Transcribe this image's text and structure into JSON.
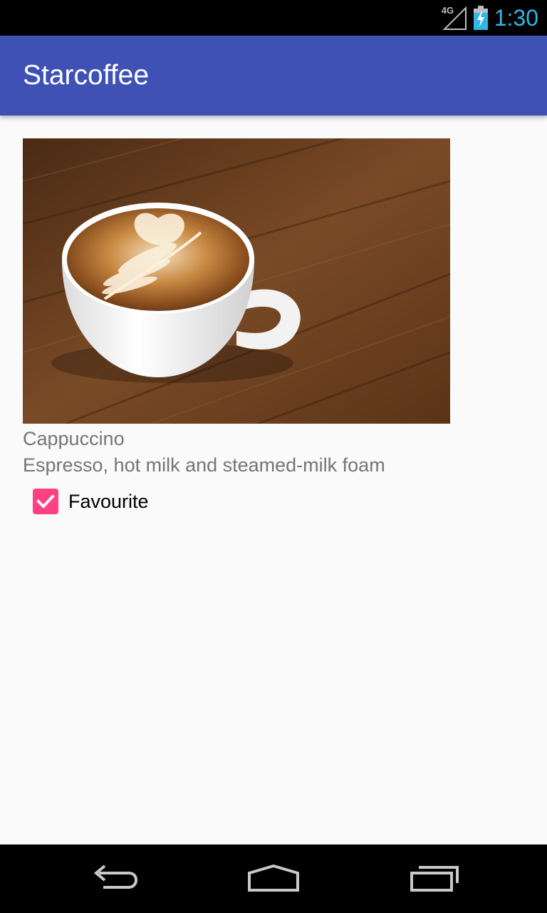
{
  "status_bar": {
    "network_type": "4G",
    "time": "1:30",
    "icons": [
      "signal-icon",
      "battery-charging-icon"
    ]
  },
  "app_bar": {
    "title": "Starcoffee"
  },
  "coffee": {
    "image_icon": "cappuccino-photo",
    "name": "Cappuccino",
    "description": "Espresso, hot milk and steamed-milk foam",
    "favourite_label": "Favourite",
    "favourite_checked": true
  },
  "nav_bar": {
    "icons": [
      "back-icon",
      "home-icon",
      "recents-icon"
    ]
  },
  "colors": {
    "primary": "#3F51B5",
    "accent": "#FF4081",
    "clock": "#33B5E5",
    "secondary_text": "#757575"
  }
}
